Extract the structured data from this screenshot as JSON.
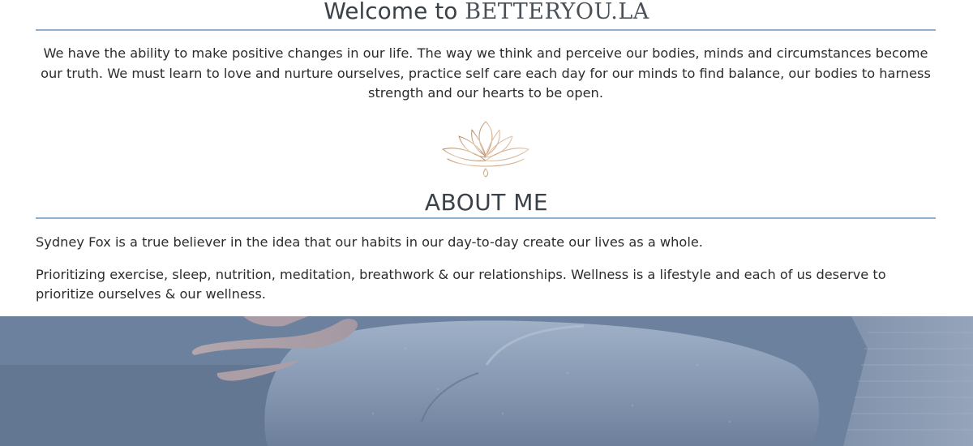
{
  "welcome": {
    "prefix": "Welcome to ",
    "brand": "BETTERYOU.LA"
  },
  "intro": {
    "text": "We have the ability to make positive changes in our life. The way we think and perceive our bodies, minds and circumstances become our truth. We must learn to love and nurture ourselves, practice self care each day for our minds to find balance, our bodies to harness strength and our hearts to be open."
  },
  "about": {
    "title": "ABOUT ME",
    "paragraphs": [
      "Sydney Fox is a true believer in the idea that our habits in our day-to-day create our lives as a whole.",
      "Prioritizing exercise, sleep, nutrition, meditation, breathwork & our relationships. Wellness is a lifestyle and each of us deserve to prioritize ourselves & our wellness."
    ]
  },
  "decor": {
    "lotus_icon": "lotus-icon",
    "lotus_color": "#c8a07a",
    "rule_color": "#8fb0cc",
    "hero_tint": "#6e84a1"
  }
}
